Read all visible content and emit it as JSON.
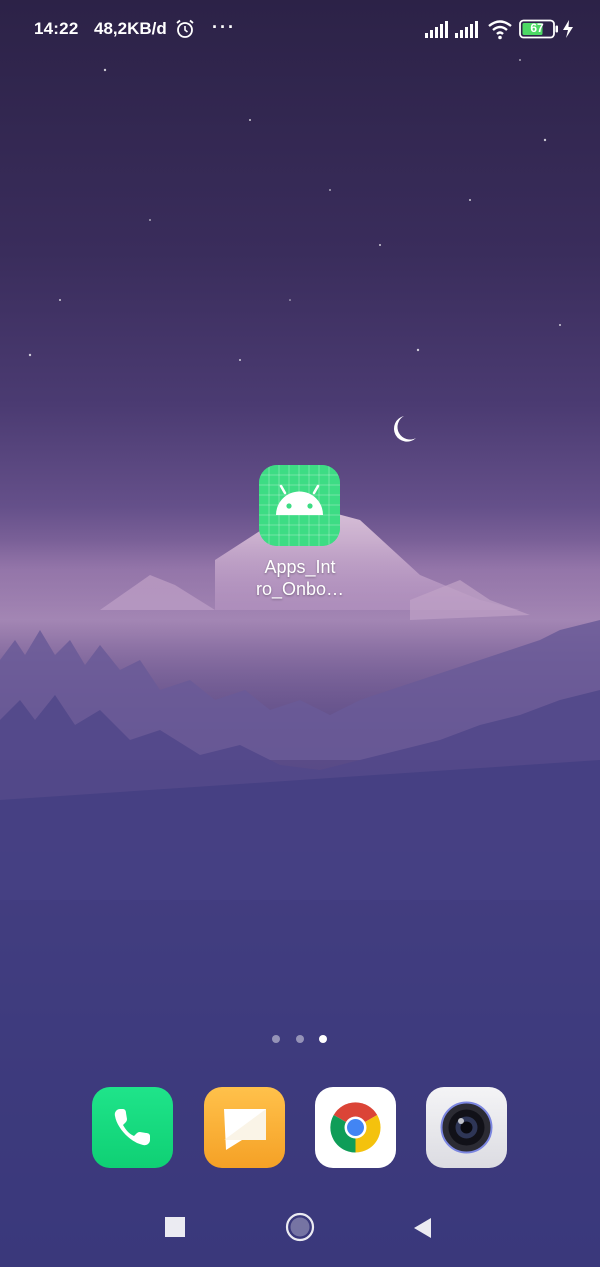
{
  "status_bar": {
    "time": "14:22",
    "network_speed": "48,2KB/d",
    "more": "···",
    "battery_percent": "67",
    "icons": [
      "alarm-icon",
      "more-dots-icon",
      "signal-icon",
      "signal-icon",
      "wifi-icon",
      "battery-icon",
      "charging-icon"
    ]
  },
  "home": {
    "app": {
      "label_line1": "Apps_Int",
      "label_line2": "ro_Onbo…",
      "icon": "android-icon",
      "color": "#3ddc84"
    },
    "pages": {
      "count": 3,
      "active_index": 2
    }
  },
  "dock": {
    "apps": [
      {
        "icon": "phone-icon",
        "color": "#10d97a"
      },
      {
        "icon": "messages-icon",
        "color": "#f7ab31"
      },
      {
        "icon": "chrome-icon",
        "color": "#ffffff"
      },
      {
        "icon": "camera-icon",
        "color": "#e6e6ea"
      }
    ]
  },
  "nav_bar": {
    "buttons": [
      "recents-icon",
      "home-icon",
      "back-icon"
    ]
  }
}
